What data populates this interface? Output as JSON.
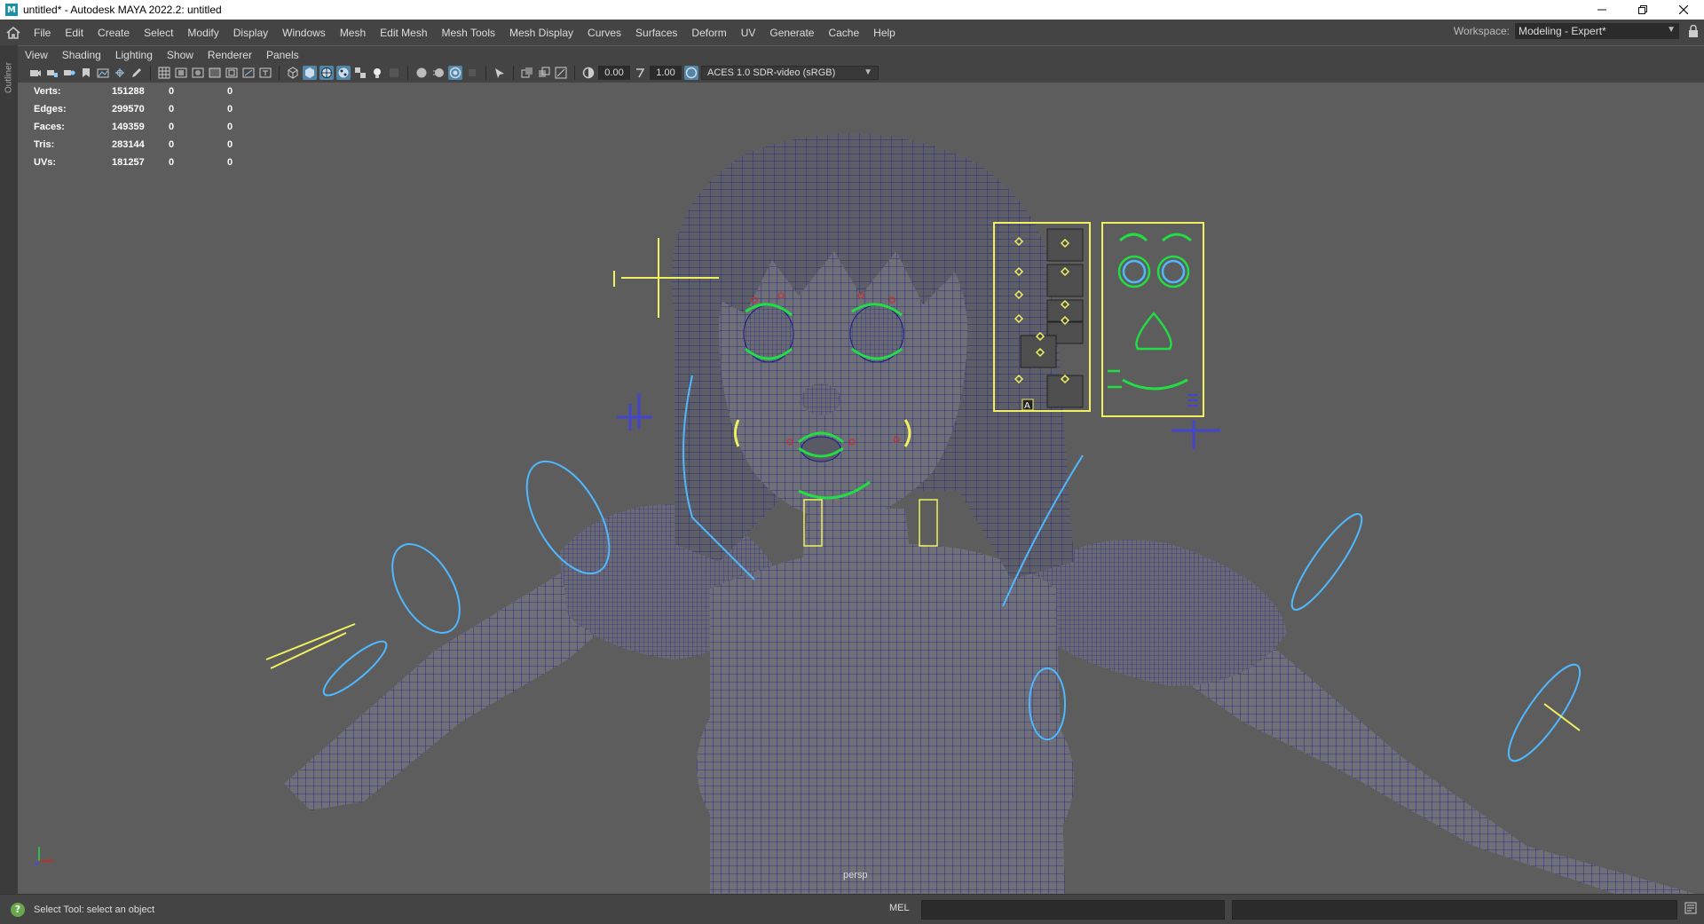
{
  "window": {
    "title": "untitled* - Autodesk MAYA 2022.2: untitled",
    "app_icon": "M"
  },
  "menubar": {
    "items": [
      "File",
      "Edit",
      "Create",
      "Select",
      "Modify",
      "Display",
      "Windows",
      "Mesh",
      "Edit Mesh",
      "Mesh Tools",
      "Mesh Display",
      "Curves",
      "Surfaces",
      "Deform",
      "UV",
      "Generate",
      "Cache",
      "Help"
    ],
    "workspace_label": "Workspace:",
    "workspace_value": "Modeling - Expert*"
  },
  "leftstrip": {
    "outliner_label": "Outliner"
  },
  "panelmenu": {
    "items": [
      "View",
      "Shading",
      "Lighting",
      "Show",
      "Renderer",
      "Panels"
    ]
  },
  "toolbar": {
    "field_1": "0.00",
    "field_2": "1.00",
    "colorspace": "ACES 1.0 SDR-video (sRGB)"
  },
  "hud": {
    "rows": [
      {
        "label": "Verts:",
        "value": "151288",
        "selected": "0",
        "uv": "0"
      },
      {
        "label": "Edges:",
        "value": "299570",
        "selected": "0",
        "uv": "0"
      },
      {
        "label": "Faces:",
        "value": "149359",
        "selected": "0",
        "uv": "0"
      },
      {
        "label": "Tris:",
        "value": "283144",
        "selected": "0",
        "uv": "0"
      },
      {
        "label": "UVs:",
        "value": "181257",
        "selected": "0",
        "uv": "0"
      }
    ]
  },
  "viewport": {
    "camera": "persp",
    "mesh_color": "#6f6f78",
    "wire_color": "#1a1a8c",
    "rig_cyan": "#4fb8ff",
    "rig_green": "#22dd44",
    "rig_yellow": "#f0f060",
    "rig_red": "#e02020",
    "panel_letter": "A"
  },
  "statusline": {
    "help_text": "Select Tool: select an object",
    "mel_label": "MEL"
  }
}
